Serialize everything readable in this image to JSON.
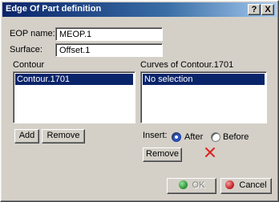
{
  "window": {
    "title": "Edge Of Part definition",
    "help_glyph": "?",
    "close_glyph": "X"
  },
  "eop": {
    "label": "EOP name:",
    "value": "MEOP.1"
  },
  "surface": {
    "label": "Surface:",
    "value": "Offset.1"
  },
  "contour": {
    "label": "Contour",
    "items": [
      "Contour.1701"
    ],
    "add_label": "Add",
    "remove_label": "Remove"
  },
  "curves": {
    "label": "Curves of Contour.1701",
    "items": [
      "No selection"
    ]
  },
  "insert": {
    "label": "Insert:",
    "options": [
      "After",
      "Before"
    ],
    "selected": "After",
    "remove_label": "Remove"
  },
  "dialog": {
    "ok_label": "OK",
    "cancel_label": "Cancel"
  },
  "colors": {
    "title_bar": "#0a246a",
    "selection": "#0a246a",
    "ok_icon": "#2e9b3a",
    "cancel_icon": "#c8262a",
    "delete_icon": "#e02020"
  }
}
